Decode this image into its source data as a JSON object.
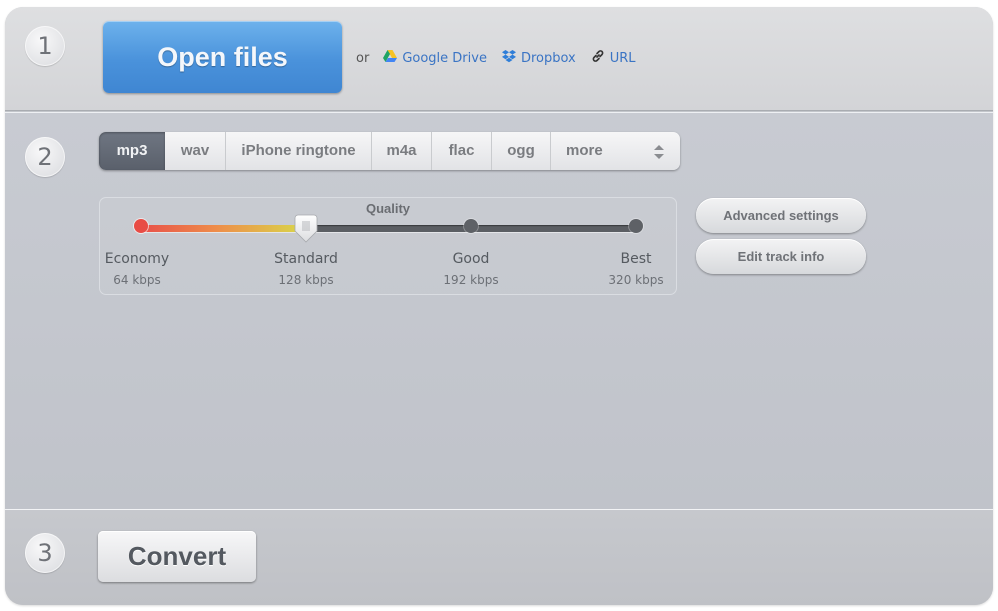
{
  "steps": [
    "1",
    "2",
    "3"
  ],
  "upload": {
    "open_files_label": "Open files",
    "or_label": "or",
    "sources": [
      {
        "label": "Google Drive",
        "icon": "google-drive-icon"
      },
      {
        "label": "Dropbox",
        "icon": "dropbox-icon"
      },
      {
        "label": "URL",
        "icon": "link-icon"
      }
    ]
  },
  "formats": {
    "tabs": [
      {
        "label": "mp3",
        "active": true
      },
      {
        "label": "wav",
        "active": false
      },
      {
        "label": "iPhone ringtone",
        "active": false
      },
      {
        "label": "m4a",
        "active": false
      },
      {
        "label": "flac",
        "active": false
      },
      {
        "label": "ogg",
        "active": false
      },
      {
        "label": "more",
        "active": false
      }
    ]
  },
  "quality": {
    "title": "Quality",
    "selected_index": 1,
    "levels": [
      {
        "label": "Economy",
        "bitrate": "64 kbps"
      },
      {
        "label": "Standard",
        "bitrate": "128 kbps"
      },
      {
        "label": "Good",
        "bitrate": "192 kbps"
      },
      {
        "label": "Best",
        "bitrate": "320 kbps"
      }
    ],
    "colors": {
      "low": "#e8504a",
      "mid": "#ee8c4a",
      "high": "#d8d84a",
      "track": "#5b5e63"
    }
  },
  "settings": {
    "advanced_label": "Advanced settings",
    "edit_track_label": "Edit track info"
  },
  "convert": {
    "label": "Convert"
  },
  "colors": {
    "accent_blue": "#4a92db",
    "link_blue": "#3a74c4"
  }
}
